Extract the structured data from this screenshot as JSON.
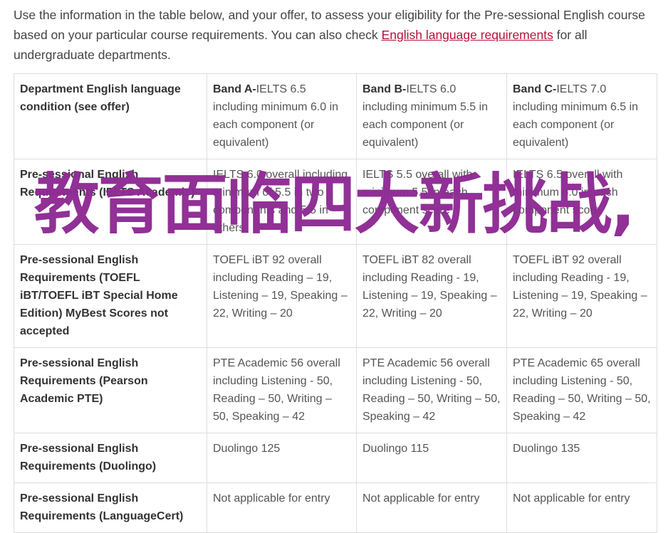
{
  "intro": {
    "text_before": "Use the information in the table below, and your offer, to assess your eligibility for the Pre-sessional English course based on your particular course requirements. You can also check ",
    "link_text": "English language requirements",
    "text_after": " for all undergraduate departments."
  },
  "table": {
    "header": {
      "label": "Department English language condition (see offer)",
      "bands": [
        {
          "name": "Band A-",
          "text": "IELTS 6.5 including minimum 6.0 in each component (or equivalent)"
        },
        {
          "name": "Band B-",
          "text": "IELTS 6.0 including minimum 5.5 in each component (or equivalent)"
        },
        {
          "name": "Band C-",
          "text": "IELTS 7.0 including minimum 6.5 in each component (or equivalent)"
        }
      ]
    },
    "rows": [
      {
        "label": "Pre-sessional English Requirements (IELTS Academic)",
        "cells": [
          "IELTS 6.0 overall including minimum of 5.5 in two components and 5.5 in others",
          "IELTS 5.5 overall with minimum 5.5 in each component score",
          "IELTS 6.5 overall with minimum 6.0 in each component score"
        ]
      },
      {
        "label": "Pre-sessional English Requirements (TOEFL iBT/TOEFL iBT Special Home Edition) MyBest Scores not accepted",
        "cells": [
          "TOEFL iBT 92 overall including Reading – 19, Listening – 19, Speaking – 22, Writing – 20",
          "TOEFL iBT 82 overall including Reading - 19, Listening – 19, Speaking – 22, Writing – 20",
          "TOEFL iBT 92 overall including Reading - 19, Listening – 19, Speaking – 22, Writing – 20"
        ]
      },
      {
        "label": "Pre-sessional English Requirements (Pearson Academic PTE)",
        "cells": [
          "PTE Academic 56 overall including Listening - 50, Reading – 50, Writing – 50, Speaking – 42",
          "PTE Academic 56 overall including Listening - 50, Reading – 50, Writing – 50, Speaking – 42",
          "PTE Academic 65 overall including Listening - 50, Reading – 50, Writing – 50, Speaking – 42"
        ]
      },
      {
        "label": "Pre-sessional English Requirements (Duolingo)",
        "cells": [
          "Duolingo 125",
          "Duolingo 115",
          "Duolingo 135"
        ]
      },
      {
        "label": "Pre-sessional English Requirements (LanguageCert)",
        "cells": [
          "Not applicable for entry",
          "Not applicable for entry",
          "Not applicable for entry"
        ]
      }
    ]
  },
  "overlay": {
    "text": "教育面临四大新挑战,",
    "color": "#8e2a93"
  },
  "colors": {
    "link": "#b3123c",
    "text": "#444444",
    "border": "#dddddd"
  }
}
